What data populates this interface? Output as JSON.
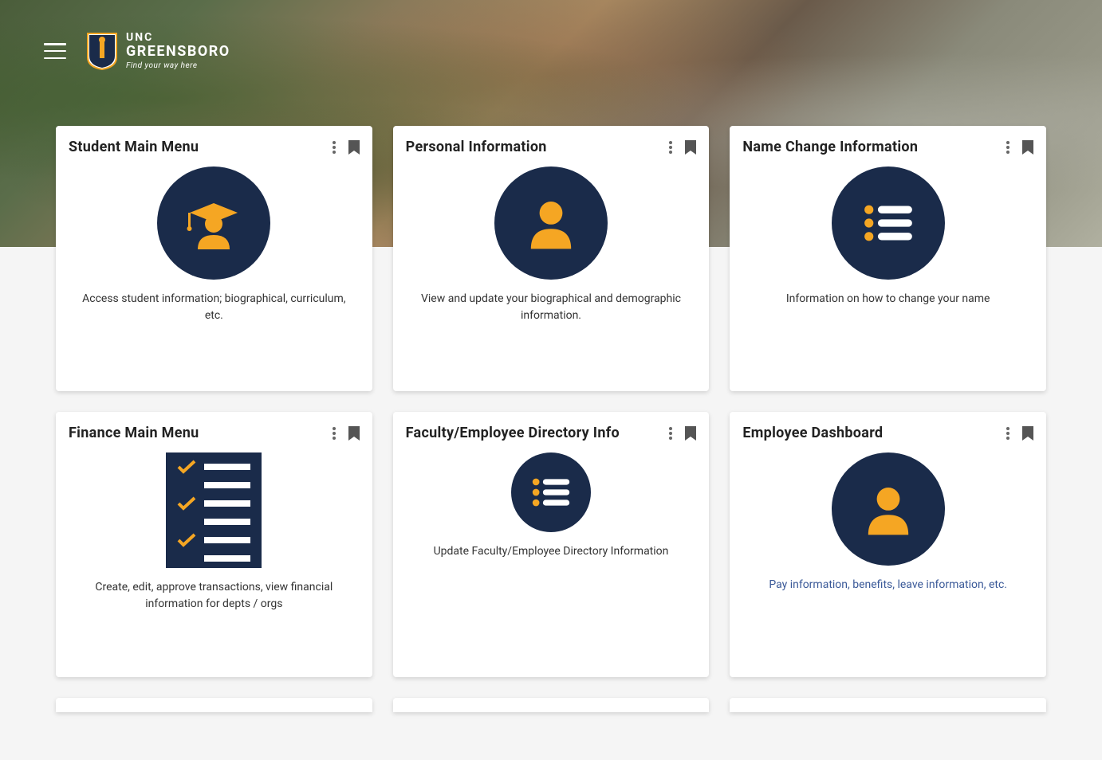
{
  "brand": {
    "line1": "UNC",
    "line2": "GREENSBORO",
    "tagline": "Find your way here"
  },
  "colors": {
    "navy": "#1a2b4a",
    "gold": "#f5a623"
  },
  "cards": [
    {
      "title": "Student Main Menu",
      "description": "Access student information; biographical, curriculum, etc.",
      "icon": "graduate",
      "link_style": false
    },
    {
      "title": "Personal Information",
      "description": "View and update your biographical and demographic information.",
      "icon": "person",
      "link_style": false
    },
    {
      "title": "Name Change Information",
      "description": "Information on how to change your name",
      "icon": "list",
      "link_style": false
    },
    {
      "title": "Finance Main Menu",
      "description": "Create, edit, approve transactions, view financial information for depts / orgs",
      "icon": "clipboard",
      "link_style": false
    },
    {
      "title": "Faculty/Employee Directory Info",
      "description": "Update Faculty/Employee Directory Information",
      "icon": "list",
      "link_style": false
    },
    {
      "title": "Employee Dashboard",
      "description": "Pay information, benefits, leave information, etc.",
      "icon": "person",
      "link_style": true
    }
  ]
}
